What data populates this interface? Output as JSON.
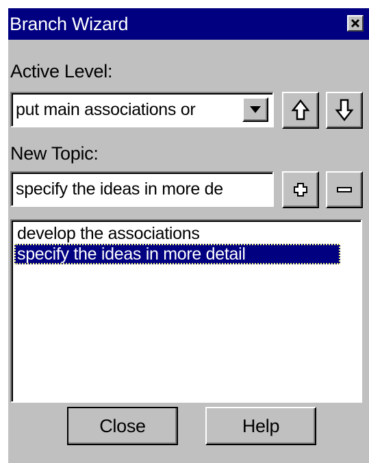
{
  "window": {
    "title": "Branch Wizard"
  },
  "active_level": {
    "label": "Active Level:",
    "selected_value": "put main associations or"
  },
  "new_topic": {
    "label": "New Topic:",
    "value": "specify the ideas in more de"
  },
  "topics_list": {
    "items": [
      {
        "label": "develop the associations",
        "selected": false
      },
      {
        "label": "specify the ideas in more detail",
        "selected": true
      }
    ]
  },
  "buttons": {
    "close_label": "Close",
    "help_label": "Help"
  },
  "icons": {
    "title_close": "close-icon",
    "dropdown": "chevron-down-icon",
    "move_up": "arrow-up-icon",
    "move_down": "arrow-down-icon",
    "add": "plus-icon",
    "remove": "minus-icon"
  },
  "colors": {
    "titlebar": "#000080",
    "face": "#c0c0c0",
    "selection": "#000080"
  }
}
